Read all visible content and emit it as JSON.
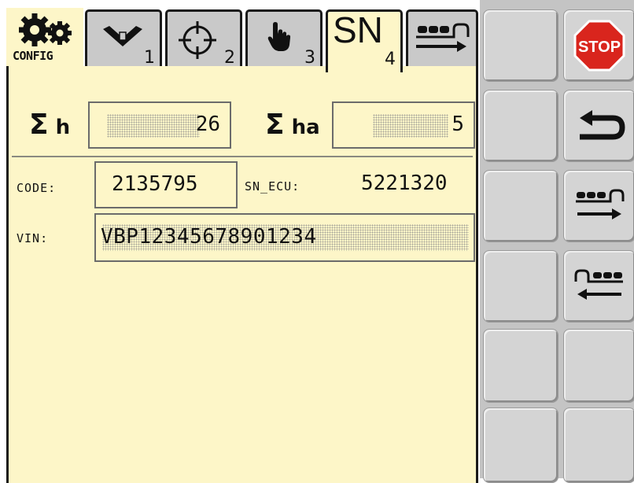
{
  "tabs": [
    {
      "id": "config",
      "label": "CONFIG",
      "icon": "gears-icon"
    },
    {
      "id": "tab1",
      "number": "1",
      "icon": "hopper-funnel-icon"
    },
    {
      "id": "tab2",
      "number": "2",
      "icon": "crosshair-icon"
    },
    {
      "id": "tab3",
      "number": "3",
      "icon": "hand-icon"
    },
    {
      "id": "tab4",
      "label": "SN",
      "number": "4",
      "active": true
    },
    {
      "id": "tab5",
      "icon": "machine-forward-icon"
    }
  ],
  "stats": {
    "hours_label": "h",
    "hours_value": "26",
    "hectares_label": "ha",
    "hectares_value": "5"
  },
  "serials": {
    "code_label": "CODE:",
    "code_value": "2135795",
    "sn_ecu_label": "SN_ECU:",
    "sn_ecu_value": "5221320",
    "vin_label": "VIN:",
    "vin_value": "VBP12345678901234"
  },
  "softkeys": [
    {
      "row": 1,
      "left": "",
      "right": "STOP",
      "right_icon": "stop-sign-icon"
    },
    {
      "row": 2,
      "left": "",
      "right_icon": "back-arrow-icon"
    },
    {
      "row": 3,
      "left": "",
      "right_icon": "machine-forward-icon"
    },
    {
      "row": 4,
      "left": "",
      "right_icon": "machine-reverse-icon"
    },
    {
      "row": 5,
      "left": "",
      "right": ""
    },
    {
      "row": 6,
      "left": "",
      "right": ""
    }
  ],
  "colors": {
    "panel": "#fdf6c8",
    "stop": "#d9251d",
    "key": "#d4d4d4"
  }
}
